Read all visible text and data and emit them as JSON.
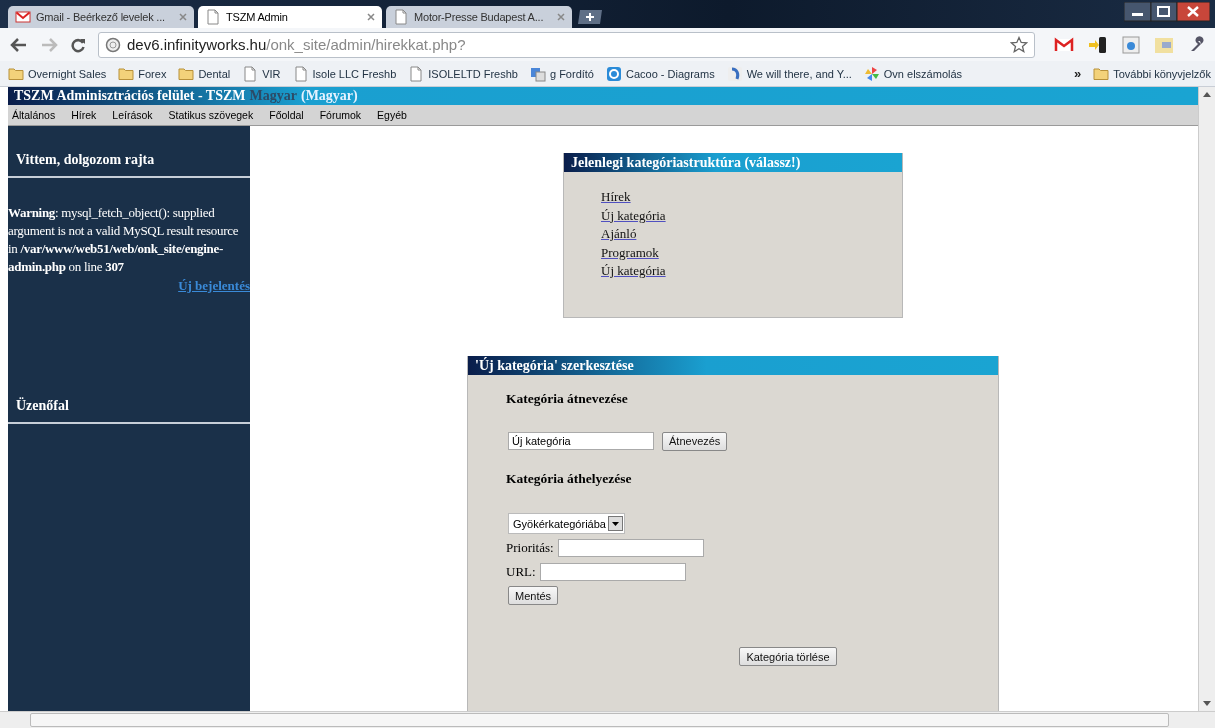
{
  "browser": {
    "tabs": [
      {
        "title": "Gmail - Beérkező levelek ...",
        "kind": "mail",
        "selected": false
      },
      {
        "title": "TSZM Admin",
        "kind": "page",
        "selected": true
      },
      {
        "title": "Motor-Presse Budapest A...",
        "kind": "page",
        "selected": false
      }
    ],
    "address": {
      "host": "dev6.infinityworks.hu",
      "path": "/onk_site/admin/hirekkat.php?"
    },
    "bookmarks": [
      {
        "label": "Overnight Sales",
        "kind": "folder"
      },
      {
        "label": "Forex",
        "kind": "folder"
      },
      {
        "label": "Dental",
        "kind": "folder"
      },
      {
        "label": "VIR",
        "kind": "page"
      },
      {
        "label": "Isole LLC Freshb",
        "kind": "page"
      },
      {
        "label": "ISOLELTD Freshb",
        "kind": "page"
      },
      {
        "label": "g Fordító",
        "kind": "translate"
      },
      {
        "label": "Cacoo - Diagrams",
        "kind": "cacoo"
      },
      {
        "label": "We will there, and Y...",
        "kind": "app"
      },
      {
        "label": "Ovn elszámolás",
        "kind": "pinwheel"
      }
    ],
    "bookmarks_overflow": "»",
    "other_bookmarks": "További könyvjelzők"
  },
  "page": {
    "header": [
      "TSZM Adminisztrációs felület - TSZM",
      "Magyar",
      "(Magyar)"
    ],
    "menu": [
      "Általános",
      "Hírek",
      "Leírások",
      "Statikus szövegek",
      "Főoldal",
      "Fórumok",
      "Egyéb"
    ],
    "sidebar": {
      "sections": [
        {
          "title": "Vittem, dolgozom rajta",
          "warning": "**Warning**: mysql_fetch_object(): supplied argument is not a valid MySQL result resource in **/var/www/web51/web/onk_site/engine-admin.php** on line **307**",
          "link": "Új bejelentés"
        },
        {
          "title": "Üzenőfal"
        }
      ]
    },
    "category_tree": {
      "title": "Jelenlegi kategóriastruktúra (válassz!)",
      "items": [
        "Hírek",
        "Új kategória",
        "Ajánló",
        "Programok",
        "Új kategória"
      ]
    },
    "edit_panel": {
      "title": "'Új kategória' szerkesztése",
      "rename_heading": "Kategória átnevezése",
      "name_value": "Új kategória",
      "rename_button": "Átnevezés",
      "move_heading": "Kategória áthelyezése",
      "parent_select": "Gyökérkategóriába",
      "priority_label": "Prioritás:",
      "url_label": "URL:",
      "save_button": "Mentés",
      "delete_button": "Kategória törlése"
    }
  }
}
